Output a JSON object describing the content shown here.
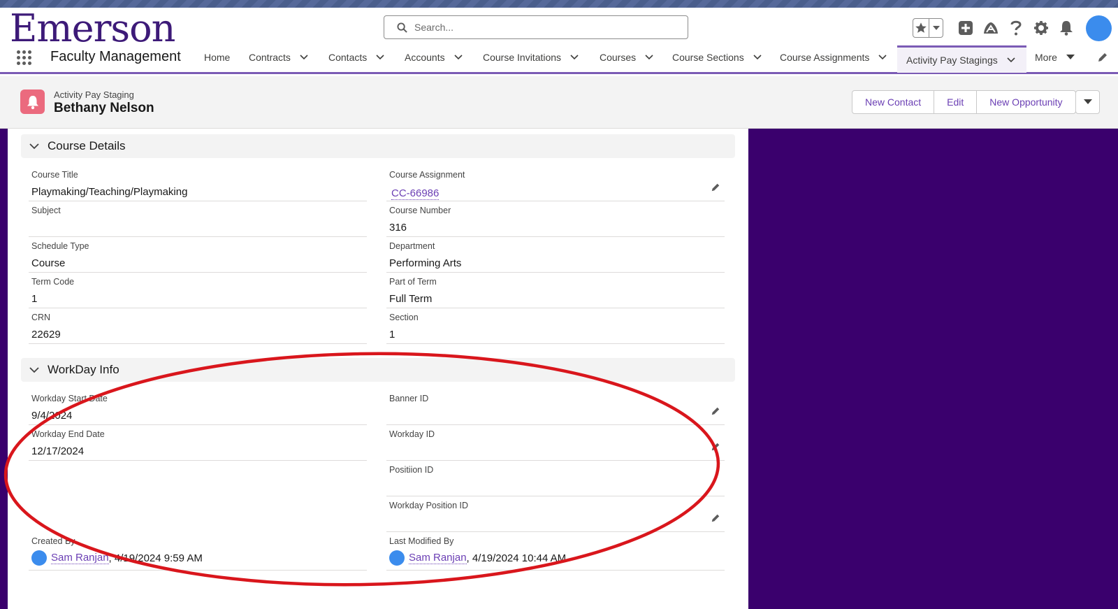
{
  "brand": {
    "logo_text": "Emerson",
    "accent": "#3d1a78",
    "link_color": "#6b3fb4",
    "side_bg": "#3a006d"
  },
  "search": {
    "placeholder": "Search..."
  },
  "app": {
    "name": "Faculty Management"
  },
  "nav": {
    "items": [
      {
        "label": "Home"
      },
      {
        "label": "Contracts"
      },
      {
        "label": "Contacts"
      },
      {
        "label": "Accounts"
      },
      {
        "label": "Course Invitations"
      },
      {
        "label": "Courses"
      },
      {
        "label": "Course Sections"
      },
      {
        "label": "Course Assignments"
      },
      {
        "label": "Activity Pay Stagings"
      },
      {
        "label": "More"
      }
    ],
    "active": "Activity Pay Stagings"
  },
  "record": {
    "type": "Activity Pay Staging",
    "name": "Bethany Nelson",
    "actions": [
      "New Contact",
      "Edit",
      "New Opportunity"
    ]
  },
  "course_details": {
    "title": "Course Details",
    "fields": [
      {
        "label": "Course Title",
        "value": "Playmaking/Teaching/Playmaking"
      },
      {
        "label": "Course Assignment",
        "value": "CC-66986"
      },
      {
        "label": "Subject",
        "value": ""
      },
      {
        "label": "Course Number",
        "value": "316"
      },
      {
        "label": "Schedule Type",
        "value": "Course"
      },
      {
        "label": "Department",
        "value": "Performing Arts"
      },
      {
        "label": "Term Code",
        "value": "1"
      },
      {
        "label": "Part of Term",
        "value": "Full Term"
      },
      {
        "label": "CRN",
        "value": "22629"
      },
      {
        "label": "Section",
        "value": "1"
      }
    ]
  },
  "workday_info": {
    "title": "WorkDay Info",
    "fields": [
      {
        "label": "Workday Start Date",
        "value": "9/4/2024"
      },
      {
        "label": "Banner ID",
        "value": ""
      },
      {
        "label": "Workday End Date",
        "value": "12/17/2024"
      },
      {
        "label": "Workday ID",
        "value": ""
      },
      {
        "label": "Positiion ID",
        "value": ""
      },
      {
        "label": "Workday Position ID",
        "value": ""
      }
    ]
  },
  "system": {
    "created_by": {
      "label": "Created By",
      "user": "Sam Ranjan",
      "date": ", 4/19/2024 9:59 AM"
    },
    "modified_by": {
      "label": "Last Modified By",
      "user": "Sam Ranjan",
      "date": ", 4/19/2024 10:44 AM"
    }
  },
  "annotation_color": "#d9161c"
}
